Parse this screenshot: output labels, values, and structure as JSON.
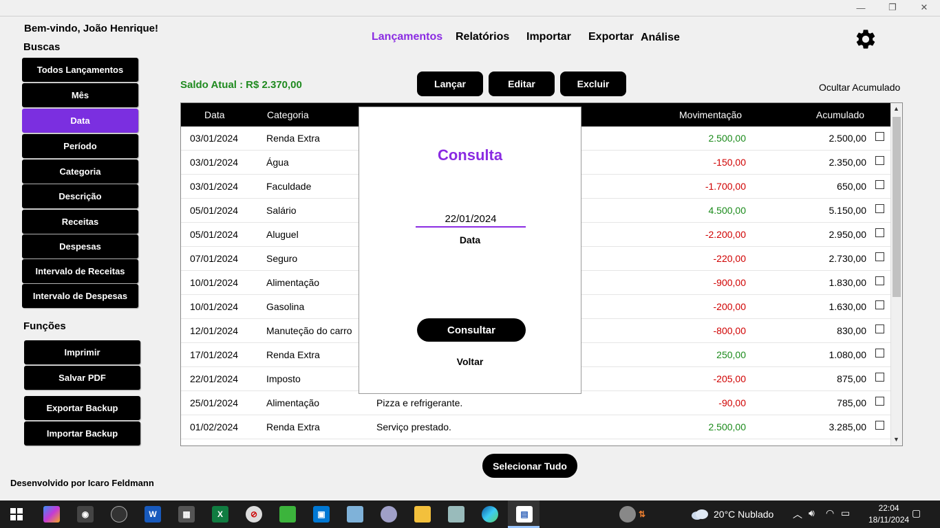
{
  "window": {
    "minimize": "—",
    "restore": "❐",
    "close": "✕"
  },
  "welcome": "Bem-vindo, João Henrique!",
  "sidebar": {
    "buscas_title": "Buscas",
    "buscas": [
      "Todos Lançamentos",
      "Mês",
      "Data",
      "Período",
      "Categoria",
      "Descrição",
      "Receitas",
      "Despesas",
      "Intervalo de Receitas",
      "Intervalo de Despesas"
    ],
    "active_index": 2,
    "funcoes_title": "Funções",
    "funcoes": [
      "Imprimir",
      "Salvar PDF",
      "Exportar Backup",
      "Importar Backup"
    ],
    "credit": "Desenvolvido por Icaro Feldmann"
  },
  "nav": {
    "items": [
      "Lançamentos",
      "Relatórios",
      "Importar",
      "Exportar",
      "Análise"
    ],
    "active": "Lançamentos"
  },
  "saldo": {
    "label": "Saldo Atual :",
    "value": "R$ 2.370,00"
  },
  "actions": {
    "lancar": "Lançar",
    "editar": "Editar",
    "excluir": "Excluir"
  },
  "ocultar": "Ocultar Acumulado",
  "table": {
    "headers": {
      "data": "Data",
      "categoria": "Categoria",
      "movimentacao": "Movimentação",
      "acumulado": "Acumulado"
    },
    "rows": [
      {
        "data": "03/01/2024",
        "categoria": "Renda Extra",
        "descricao": "",
        "mov": "2.500,00",
        "acc": "2.500,00",
        "sign": "pos"
      },
      {
        "data": "03/01/2024",
        "categoria": "Água",
        "descricao": "",
        "mov": "-150,00",
        "acc": "2.350,00",
        "sign": "neg"
      },
      {
        "data": "03/01/2024",
        "categoria": "Faculdade",
        "descricao": "",
        "mov": "-1.700,00",
        "acc": "650,00",
        "sign": "neg"
      },
      {
        "data": "05/01/2024",
        "categoria": "Salário",
        "descricao": "",
        "mov": "4.500,00",
        "acc": "5.150,00",
        "sign": "pos"
      },
      {
        "data": "05/01/2024",
        "categoria": "Aluguel",
        "descricao": "",
        "mov": "-2.200,00",
        "acc": "2.950,00",
        "sign": "neg"
      },
      {
        "data": "07/01/2024",
        "categoria": "Seguro",
        "descricao": "",
        "mov": "-220,00",
        "acc": "2.730,00",
        "sign": "neg"
      },
      {
        "data": "10/01/2024",
        "categoria": "Alimentação",
        "descricao": "",
        "mov": "-900,00",
        "acc": "1.830,00",
        "sign": "neg"
      },
      {
        "data": "10/01/2024",
        "categoria": "Gasolina",
        "descricao": "",
        "mov": "-200,00",
        "acc": "1.630,00",
        "sign": "neg"
      },
      {
        "data": "12/01/2024",
        "categoria": "Manuteção do carro",
        "descricao": "",
        "mov": "-800,00",
        "acc": "830,00",
        "sign": "neg"
      },
      {
        "data": "17/01/2024",
        "categoria": "Renda Extra",
        "descricao": "",
        "mov": "250,00",
        "acc": "1.080,00",
        "sign": "pos"
      },
      {
        "data": "22/01/2024",
        "categoria": "Imposto",
        "descricao": "",
        "mov": "-205,00",
        "acc": "875,00",
        "sign": "neg"
      },
      {
        "data": "25/01/2024",
        "categoria": "Alimentação",
        "descricao": "Pizza e refrigerante.",
        "mov": "-90,00",
        "acc": "785,00",
        "sign": "neg"
      },
      {
        "data": "01/02/2024",
        "categoria": "Renda Extra",
        "descricao": "Serviço prestado.",
        "mov": "2.500,00",
        "acc": "3.285,00",
        "sign": "pos"
      }
    ]
  },
  "modal": {
    "title": "Consulta",
    "input_value": "22/01/2024",
    "input_label": "Data",
    "consultar": "Consultar",
    "voltar": "Voltar"
  },
  "select_all": "Selecionar Tudo",
  "taskbar": {
    "weather": "20°C  Nublado",
    "time": "22:04",
    "date": "18/11/2024"
  },
  "colors": {
    "accent": "#8a2be2",
    "positive": "#1a8a1a",
    "negative": "#d00000",
    "saldo": "#1f8a1f"
  }
}
